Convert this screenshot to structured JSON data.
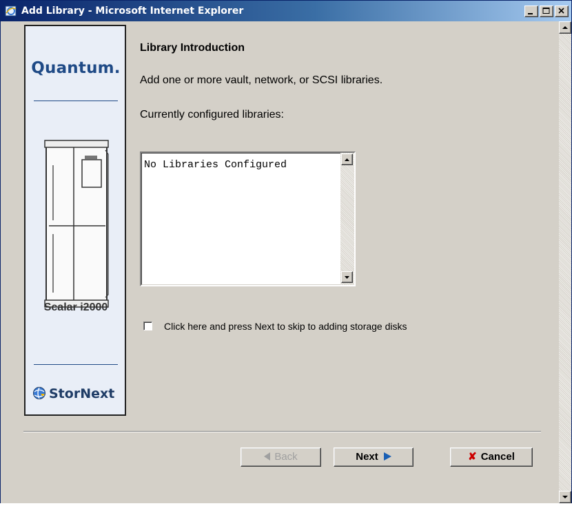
{
  "window": {
    "title": "Add Library - Microsoft Internet Explorer"
  },
  "side_panel": {
    "logo": "Quantum.",
    "product": "Scalar i2000",
    "brand": "StorNext"
  },
  "content": {
    "heading": "Library Introduction",
    "intro": "Add one or more vault, network, or SCSI libraries.",
    "current_label": "Currently configured libraries:",
    "libraries": [
      "No Libraries Configured"
    ],
    "skip_checkbox_label": "Click here and press Next to skip to adding storage disks",
    "skip_checked": false
  },
  "buttons": {
    "back": "Back",
    "next": "Next",
    "cancel": "Cancel"
  },
  "colors": {
    "brand_blue": "#1f4a86",
    "cancel_x": "#cc0000",
    "next_arrow": "#1a5fb4"
  }
}
